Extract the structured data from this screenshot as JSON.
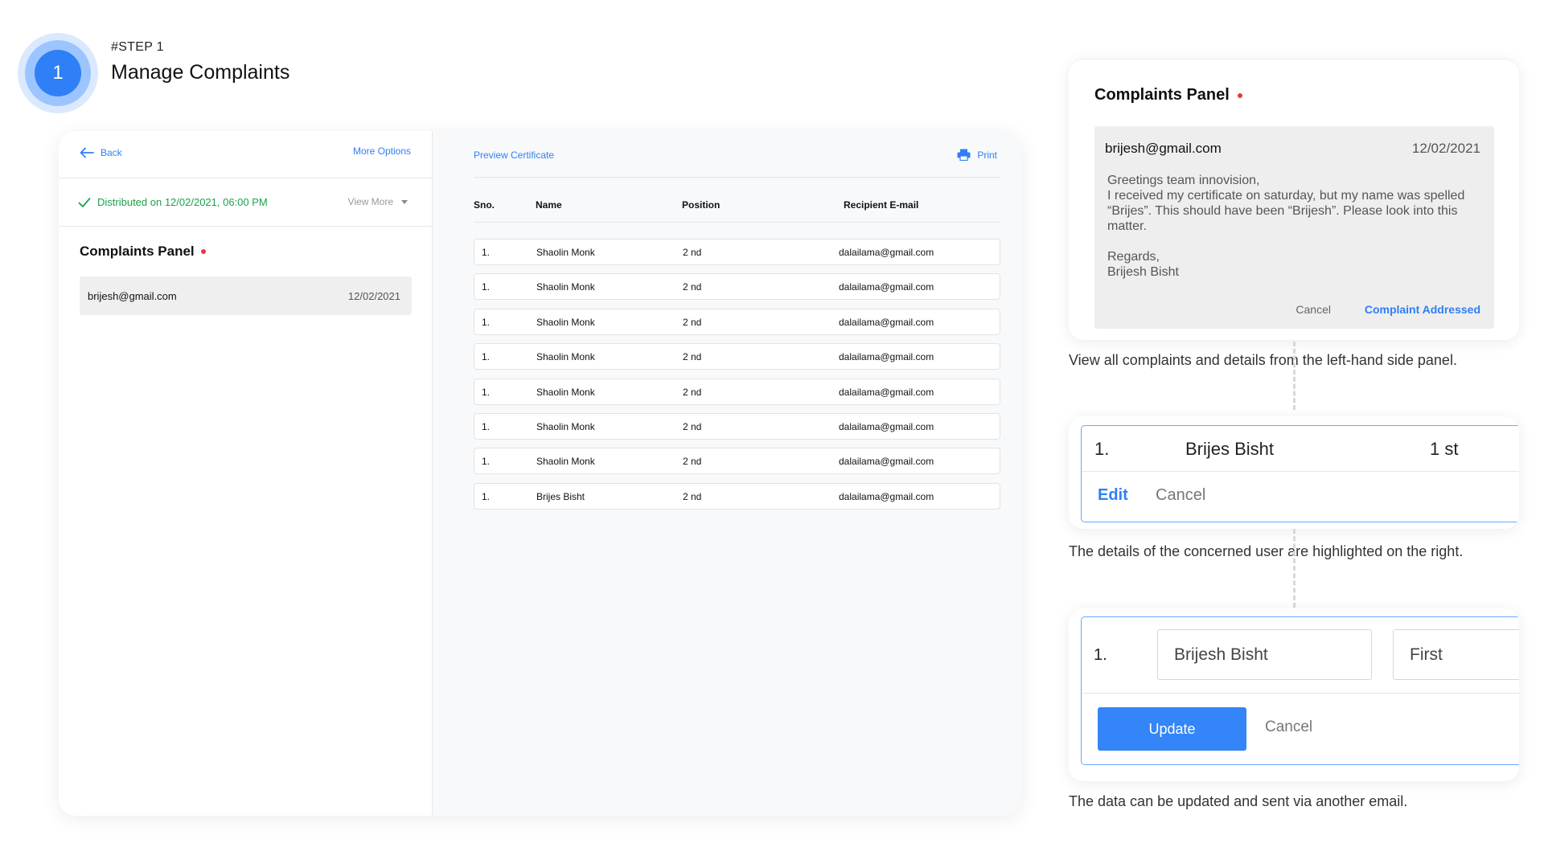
{
  "step": {
    "number": "1",
    "kicker": "#STEP 1",
    "title": "Manage Complaints"
  },
  "app": {
    "left": {
      "back_label": "Back",
      "more_options_label": "More Options",
      "distributed_text": "Distributed on 12/02/2021, 06:00 PM",
      "view_more_label": "View More",
      "panel_title": "Complaints Panel",
      "complaint": {
        "email": "brijesh@gmail.com",
        "date": "12/02/2021"
      }
    },
    "right": {
      "preview_label": "Preview Certificate",
      "print_label": "Print",
      "columns": [
        "Sno.",
        "Name",
        "Position",
        "Recipient E-mail"
      ],
      "rows": [
        {
          "sno": "1.",
          "name": "Shaolin Monk",
          "position": "2 nd",
          "email": "dalailama@gmail.com"
        },
        {
          "sno": "1.",
          "name": "Shaolin Monk",
          "position": "2 nd",
          "email": "dalailama@gmail.com"
        },
        {
          "sno": "1.",
          "name": "Shaolin Monk",
          "position": "2 nd",
          "email": "dalailama@gmail.com"
        },
        {
          "sno": "1.",
          "name": "Shaolin Monk",
          "position": "2 nd",
          "email": "dalailama@gmail.com"
        },
        {
          "sno": "1.",
          "name": "Shaolin Monk",
          "position": "2 nd",
          "email": "dalailama@gmail.com"
        },
        {
          "sno": "1.",
          "name": "Shaolin Monk",
          "position": "2 nd",
          "email": "dalailama@gmail.com"
        },
        {
          "sno": "1.",
          "name": "Shaolin Monk",
          "position": "2 nd",
          "email": "dalailama@gmail.com"
        },
        {
          "sno": "1.",
          "name": "Brijes Bisht",
          "position": "2 nd",
          "email": "dalailama@gmail.com"
        }
      ]
    }
  },
  "complaint_card": {
    "title": "Complaints Panel",
    "email": "brijesh@gmail.com",
    "date": "12/02/2021",
    "message_lines": [
      "Greetings team innovision,",
      "I received my certificate on saturday, but my name was spelled “Brijes”. This should have been  “Brijesh”. Please look into this matter.",
      "",
      "Regards,",
      "Brijesh Bisht"
    ],
    "cancel_label": "Cancel",
    "addressed_label": "Complaint Addressed"
  },
  "captions": [
    "View all complaints and details from the left-hand side panel.",
    "The details of the concerned user are highlighted on the right.",
    "The data can be updated and sent via another email."
  ],
  "highlight_row": {
    "num": "1.",
    "name": "Brijes Bisht",
    "position": "1 st",
    "edit_label": "Edit",
    "cancel_label": "Cancel"
  },
  "edit_row": {
    "num": "1.",
    "name_value": "Brijesh Bisht",
    "position_value": "First",
    "update_label": "Update",
    "cancel_label": "Cancel"
  },
  "colors": {
    "accent": "#2f7ff7",
    "success": "#1aa34a",
    "alert": "#e53935"
  }
}
